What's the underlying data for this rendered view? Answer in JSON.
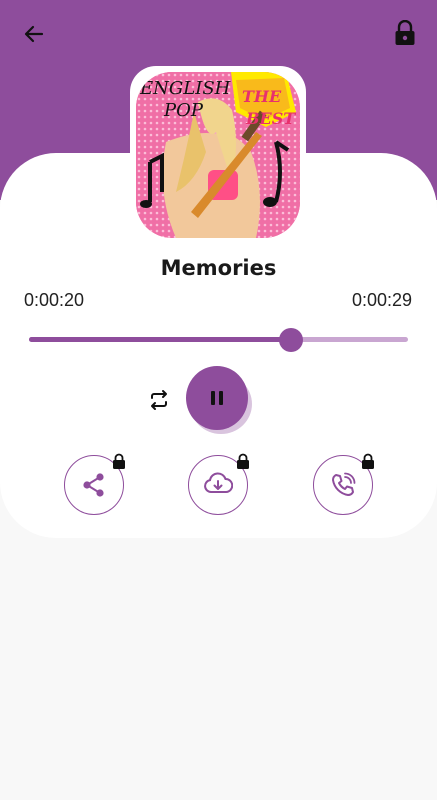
{
  "song": {
    "title": "Memories"
  },
  "player": {
    "elapsed": "0:00:20",
    "duration": "0:00:29",
    "progress": 0.69,
    "state": "playing"
  },
  "album_art": {
    "text_line1": "ENGLISH",
    "text_line2": "POP",
    "badge_line1": "THE",
    "badge_line2": "BEST"
  },
  "icons": {
    "back": "arrow-left-icon",
    "lock": "lock-icon",
    "repeat": "repeat-icon",
    "pause": "pause-icon",
    "share": "share-icon",
    "download": "cloud-download-icon",
    "ringtone": "phone-ring-icon"
  },
  "colors": {
    "accent": "#8e4d9c",
    "accent_light": "#c9a6d1"
  }
}
